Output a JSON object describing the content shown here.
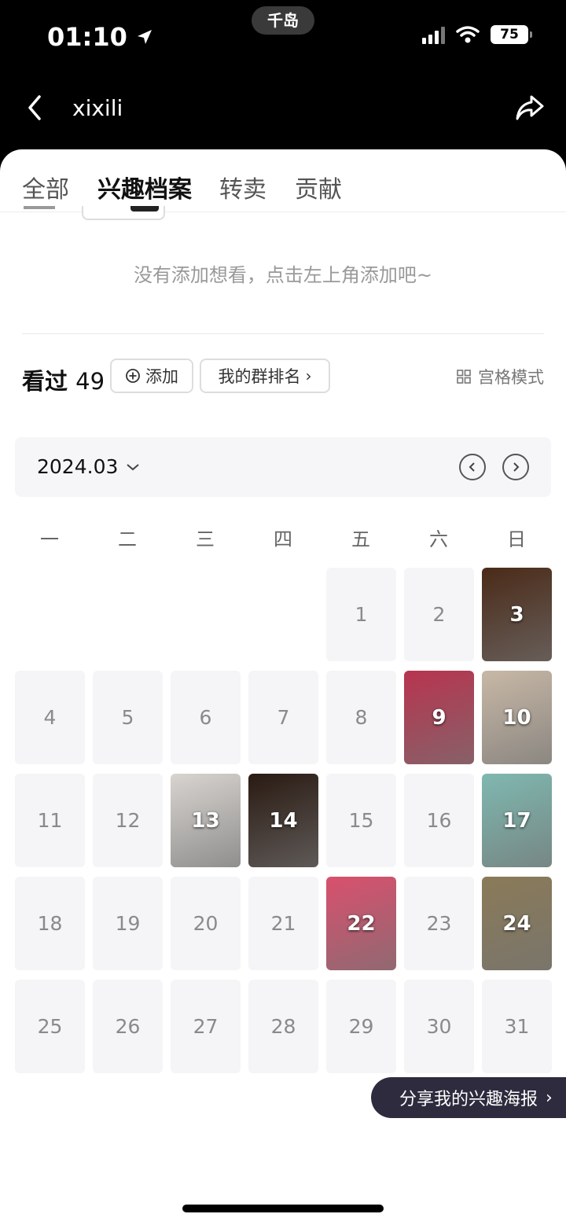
{
  "status_bar": {
    "time": "01:10",
    "island_text": "千岛",
    "battery": "75"
  },
  "header": {
    "title": "xixili"
  },
  "tabs": [
    {
      "label": "全部",
      "active": false
    },
    {
      "label": "兴趣档案",
      "active": true
    },
    {
      "label": "转卖",
      "active": false
    },
    {
      "label": "贡献",
      "active": false
    }
  ],
  "want_empty_text": "没有添加想看，点击左上角添加吧~",
  "seen": {
    "label": "看过",
    "count": "49",
    "add_label": "添加",
    "rank_label": "我的群排名",
    "grid_mode_label": "宫格模式"
  },
  "calendar": {
    "month": "2024.03",
    "weekdays": [
      "一",
      "二",
      "三",
      "四",
      "五",
      "六",
      "日"
    ],
    "days": [
      {
        "day": "1",
        "poster": false
      },
      {
        "day": "2",
        "poster": false
      },
      {
        "day": "3",
        "poster": true,
        "bg": "#4a2a18"
      },
      {
        "day": "4",
        "poster": false
      },
      {
        "day": "5",
        "poster": false
      },
      {
        "day": "6",
        "poster": false
      },
      {
        "day": "7",
        "poster": false
      },
      {
        "day": "8",
        "poster": false
      },
      {
        "day": "9",
        "poster": true,
        "bg": "#b8344f"
      },
      {
        "day": "10",
        "poster": true,
        "bg": "#c8b8a6"
      },
      {
        "day": "11",
        "poster": false
      },
      {
        "day": "12",
        "poster": false
      },
      {
        "day": "13",
        "poster": true,
        "bg": "#d8d4d0"
      },
      {
        "day": "14",
        "poster": true,
        "bg": "#2a1a12"
      },
      {
        "day": "15",
        "poster": false
      },
      {
        "day": "16",
        "poster": false
      },
      {
        "day": "17",
        "poster": true,
        "bg": "#7fb8b0"
      },
      {
        "day": "18",
        "poster": false
      },
      {
        "day": "19",
        "poster": false
      },
      {
        "day": "20",
        "poster": false
      },
      {
        "day": "21",
        "poster": false
      },
      {
        "day": "22",
        "poster": true,
        "bg": "#d9506e"
      },
      {
        "day": "23",
        "poster": false
      },
      {
        "day": "24",
        "poster": true,
        "bg": "#8a7a58"
      },
      {
        "day": "25",
        "poster": false
      },
      {
        "day": "26",
        "poster": false
      },
      {
        "day": "27",
        "poster": false
      },
      {
        "day": "28",
        "poster": false
      },
      {
        "day": "29",
        "poster": false
      },
      {
        "day": "30",
        "poster": false
      },
      {
        "day": "31",
        "poster": false
      }
    ]
  },
  "share_poster_label": "分享我的兴趣海报"
}
